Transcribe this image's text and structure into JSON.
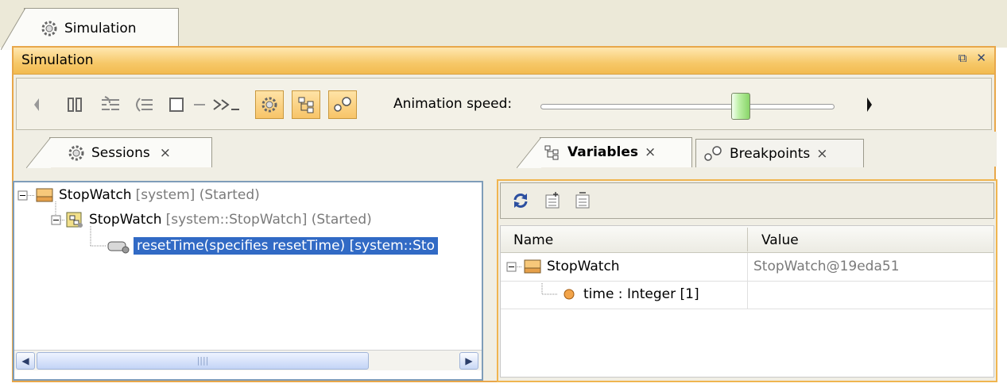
{
  "outer_tab": {
    "label": "Simulation"
  },
  "window": {
    "title": "Simulation",
    "controls": [
      "restore-icon",
      "close-icon"
    ]
  },
  "toolbar": {
    "buttons": [
      "step-back-icon",
      "pause-icon",
      "step-into-icon",
      "step-over-icon",
      "stop-icon",
      "step-out-icon",
      "run-icon"
    ],
    "toggles": [
      "sessions-toggle-icon",
      "variables-toggle-icon",
      "breakpoints-toggle-icon"
    ],
    "animation_label": "Animation speed:",
    "animation_speed": 0.68
  },
  "sessions_panel": {
    "tab_label": "Sessions",
    "close": "×",
    "tree": [
      {
        "name": "StopWatch",
        "detail": "[system] (Started)",
        "level": 0,
        "icon": "class-icon",
        "expanded": true
      },
      {
        "name": "StopWatch",
        "detail": "[system::StopWatch] (Started)",
        "level": 1,
        "icon": "state-machine-icon",
        "expanded": true
      },
      {
        "name": "resetTime(specifies resetTime) [system::Sto",
        "detail": "",
        "level": 2,
        "icon": "operation-icon",
        "selected": true
      }
    ]
  },
  "variables_panel": {
    "tabs": [
      {
        "label": "Variables",
        "active": true,
        "close": "×"
      },
      {
        "label": "Breakpoints",
        "active": false,
        "close": "×"
      }
    ],
    "toolbar_icons": [
      "refresh-icon",
      "expand-icon",
      "collapse-icon"
    ],
    "columns": [
      "Name",
      "Value"
    ],
    "rows": [
      {
        "name": "StopWatch",
        "value": "StopWatch@19eda51",
        "icon": "class-icon"
      },
      {
        "name": "time : Integer [1]",
        "value": "",
        "icon": "property-icon"
      }
    ]
  },
  "colors": {
    "accent": "#f2bb50",
    "selection": "#316ac5",
    "panel_border": "#7f9db9"
  }
}
